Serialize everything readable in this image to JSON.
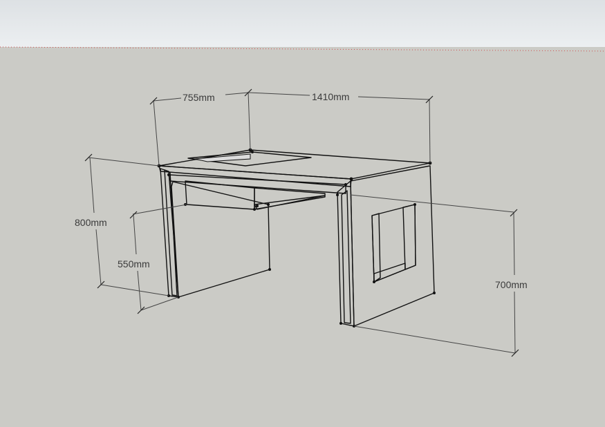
{
  "colors": {
    "sky": "#e6e9ec",
    "ground": "#cbcbc6",
    "top_surface": "#6e6e6e",
    "panel": "#c8c8c8",
    "selection": "#a9c7f0",
    "horizon": "#d05050"
  },
  "dimensions": {
    "depth_top": "755mm",
    "width_top": "1410mm",
    "height_total": "800mm",
    "height_inner": "550mm",
    "height_right": "700mm"
  }
}
